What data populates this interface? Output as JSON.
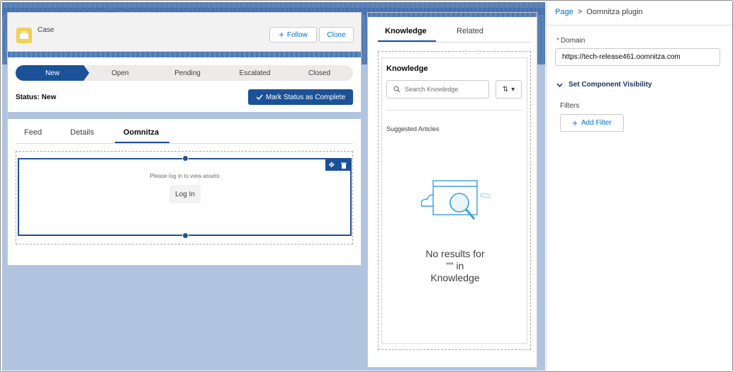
{
  "highlights": {
    "object_label": "Case",
    "follow_label": "Follow",
    "clone_label": "Clone",
    "icon": "briefcase-icon"
  },
  "path": {
    "stages": [
      {
        "label": "New",
        "current": true
      },
      {
        "label": "Open",
        "current": false
      },
      {
        "label": "Pending",
        "current": false
      },
      {
        "label": "Escalated",
        "current": false
      },
      {
        "label": "Closed",
        "current": false
      }
    ],
    "status_text": "Status: New",
    "mark_complete_label": "Mark Status as Complete"
  },
  "record_tabs": {
    "tabs": [
      "Feed",
      "Details",
      "Oomnitza"
    ],
    "active": "Oomnitza"
  },
  "oomnitza_component": {
    "message": "Please log in to view assets",
    "login_label": "Log In"
  },
  "sidebar_tabs": {
    "tabs": [
      "Knowledge",
      "Related"
    ],
    "active": "Knowledge"
  },
  "knowledge": {
    "title": "Knowledge",
    "search_placeholder": "Search Knowledge",
    "suggested_label": "Suggested Articles",
    "no_results_line1": "No results for",
    "no_results_line2": "\"\" in",
    "no_results_line3": "Knowledge"
  },
  "properties": {
    "breadcrumb_root": "Page",
    "breadcrumb_separator": ">",
    "breadcrumb_current": "Oomnitza plugin",
    "domain_label": "Domain",
    "domain_required_mark": "*",
    "domain_value": "https://tech-release461.oomnitza.com",
    "visibility_heading": "Set Component Visibility",
    "filters_label": "Filters",
    "add_filter_label": "Add Filter"
  },
  "colors": {
    "brand_dark": "#1b5297",
    "link": "#0070d2",
    "case_icon": "#f2cf5b",
    "canvas": "#b0c4df"
  }
}
